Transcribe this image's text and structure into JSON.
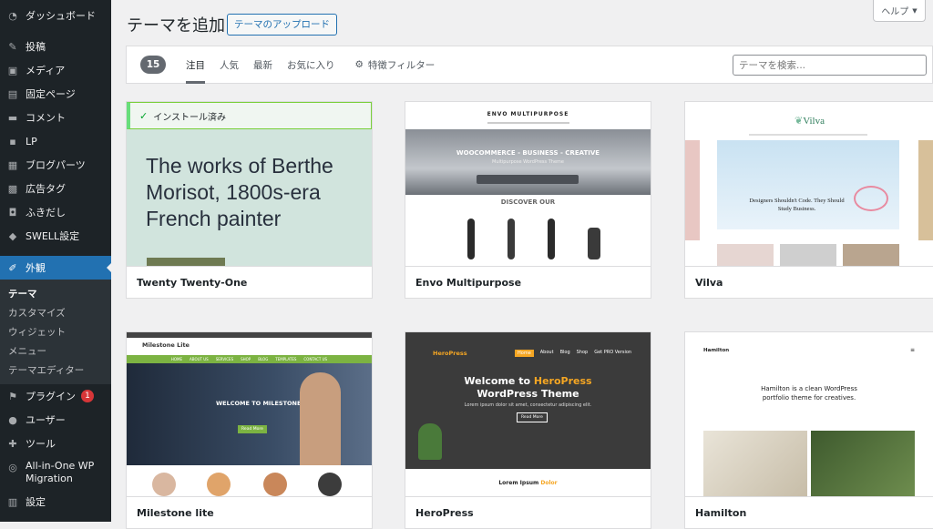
{
  "sidebar": {
    "items": [
      {
        "label": "ダッシュボード",
        "icon": "dashboard-icon"
      },
      {
        "label": "投稿",
        "icon": "pin-icon"
      },
      {
        "label": "メディア",
        "icon": "media-icon"
      },
      {
        "label": "固定ページ",
        "icon": "page-icon"
      },
      {
        "label": "コメント",
        "icon": "comment-icon"
      },
      {
        "label": "LP",
        "icon": "lp-icon"
      },
      {
        "label": "ブログパーツ",
        "icon": "blogparts-icon"
      },
      {
        "label": "広告タグ",
        "icon": "ad-tag-icon"
      },
      {
        "label": "ふきだし",
        "icon": "balloon-icon"
      },
      {
        "label": "SWELL設定",
        "icon": "swell-icon"
      },
      {
        "label": "外観",
        "icon": "brush-icon"
      }
    ],
    "submenu": [
      "テーマ",
      "カスタマイズ",
      "ウィジェット",
      "メニュー",
      "テーマエディター"
    ],
    "items_after": [
      {
        "label": "プラグイン",
        "icon": "plugin-icon",
        "badge": "1"
      },
      {
        "label": "ユーザー",
        "icon": "user-icon"
      },
      {
        "label": "ツール",
        "icon": "wrench-icon"
      },
      {
        "label": "All-in-One WP Migration",
        "icon": "migration-icon"
      },
      {
        "label": "設定",
        "icon": "settings-icon"
      }
    ]
  },
  "header": {
    "title": "テーマを追加",
    "upload_label": "テーマのアップロード",
    "help_label": "ヘルプ"
  },
  "filter": {
    "count": "15",
    "tabs": [
      "注目",
      "人気",
      "最新",
      "お気に入り"
    ],
    "feature_filter": "特徴フィルター",
    "search_placeholder": "テーマを検索..."
  },
  "themes": [
    {
      "name": "Twenty Twenty-One",
      "installed_label": "インストール済み",
      "preview_text": "The works of Berthe Morisot, 1800s-era French painter"
    },
    {
      "name": "Envo Multipurpose",
      "logo": "ENVO MULTIPURPOSE",
      "banner": "WOOCOMMERCE - BUSINESS - CREATIVE",
      "banner_sub": "Multipurpose WordPress Theme",
      "section": "DISCOVER OUR"
    },
    {
      "name": "Vilva",
      "logo": "Vilva",
      "hero": "Designers Shouldn't Code. They Should Study Business."
    },
    {
      "name": "Milestone lite",
      "logo": "Milestone Lite",
      "nav": [
        "HOME",
        "ABOUT US",
        "SERVICES",
        "SHOP",
        "BLOG",
        "TEMPLATES",
        "CONTACT US"
      ],
      "hero": "WELCOME TO MILESTONE",
      "button": "Read More"
    },
    {
      "name": "HeroPress",
      "logo": "HeroPress",
      "nav": [
        "Home",
        "About",
        "Blog",
        "Shop",
        "Get PRO Version"
      ],
      "hero_line1": "Welcome to ",
      "hero_accent": "HeroPress",
      "hero_line2": "WordPress Theme",
      "hero_sub": "Lorem ipsum dolor sit amet, consectetur adipiscing elit.",
      "button": "Read More",
      "footer_title": "Lorem Ipsum ",
      "footer_accent": "Dolor"
    },
    {
      "name": "Hamilton",
      "logo": "Hamilton",
      "tagline": "Hamilton is a clean WordPress portfolio theme for creatives."
    }
  ],
  "colors": {
    "sidebar": "#1d2327",
    "accent": "#2271b1",
    "badge": "#d63638"
  }
}
